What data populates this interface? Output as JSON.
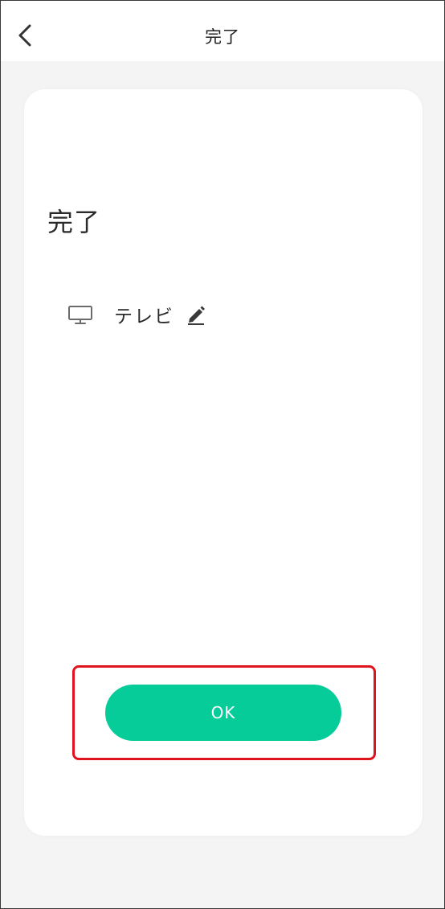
{
  "header": {
    "title": "完了",
    "back_icon": "chevron-left-icon"
  },
  "card": {
    "heading": "完了",
    "device": {
      "icon": "tv-icon",
      "name": "テレビ",
      "edit_icon": "pencil-icon"
    },
    "ok_label": "OK"
  },
  "colors": {
    "accent": "#05cc98",
    "highlight": "#e0141f",
    "background": "#f4f4f4",
    "card": "#ffffff",
    "text": "#2a2a2a"
  }
}
